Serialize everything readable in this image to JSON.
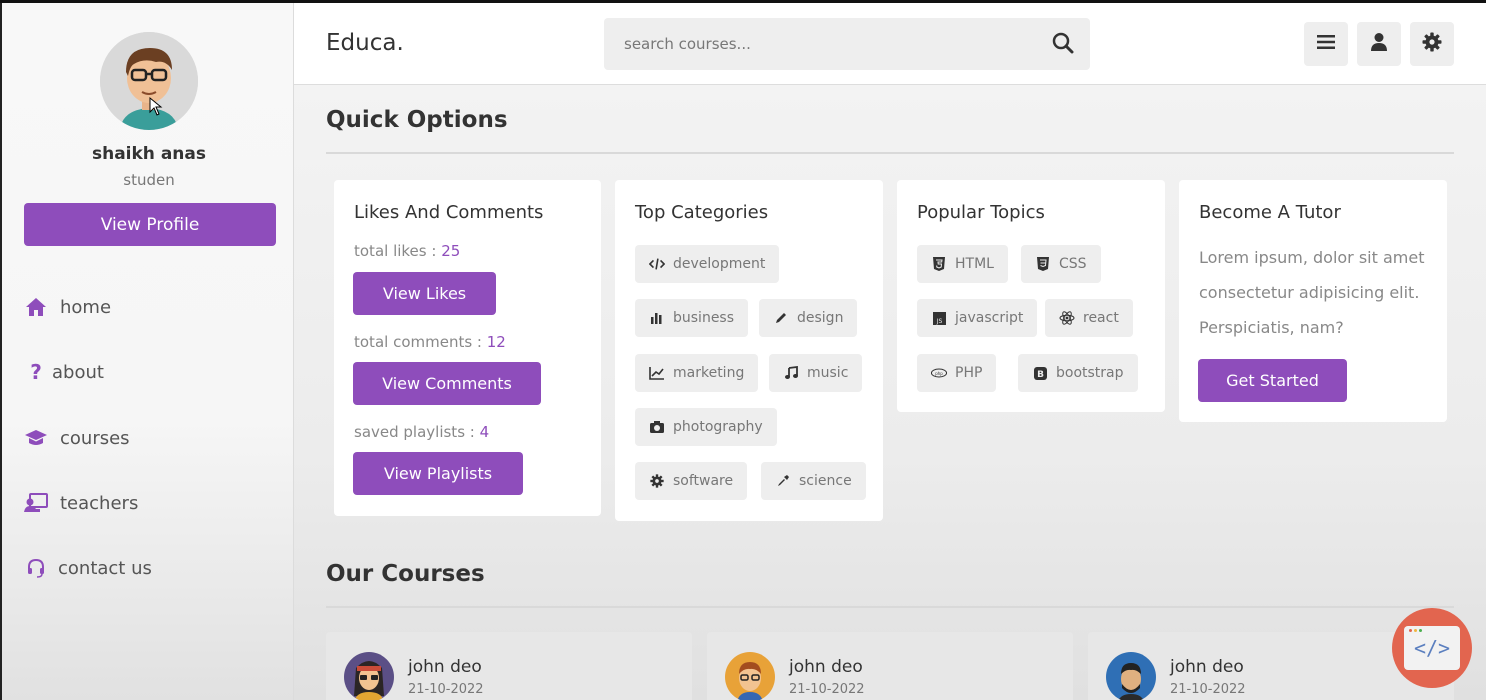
{
  "sidebar": {
    "profile": {
      "name": "shaikh anas",
      "role": "studen",
      "button": "View Profile"
    },
    "nav": [
      {
        "label": "home",
        "icon": "home-icon"
      },
      {
        "label": "about",
        "icon": "question-icon"
      },
      {
        "label": "courses",
        "icon": "graduation-cap-icon"
      },
      {
        "label": "teachers",
        "icon": "chalkboard-teacher-icon"
      },
      {
        "label": "contact us",
        "icon": "headset-icon"
      }
    ]
  },
  "header": {
    "logo": "Educa.",
    "search": {
      "placeholder": "search courses..."
    },
    "icons": [
      "menu-icon",
      "user-icon",
      "gear-icon"
    ]
  },
  "quick_options": {
    "title": "Quick Options",
    "likes_card": {
      "title": "Likes And Comments",
      "likes_label": "total likes : ",
      "likes_value": "25",
      "likes_button": "View Likes",
      "comments_label": "total comments : ",
      "comments_value": "12",
      "comments_button": "View Comments",
      "playlists_label": "saved playlists : ",
      "playlists_value": "4",
      "playlists_button": "View Playlists"
    },
    "categories_card": {
      "title": "Top Categories",
      "tags": [
        {
          "label": "development",
          "icon": "code-icon"
        },
        {
          "label": "business",
          "icon": "bar-chart-icon"
        },
        {
          "label": "design",
          "icon": "pen-icon"
        },
        {
          "label": "marketing",
          "icon": "line-chart-icon"
        },
        {
          "label": "music",
          "icon": "music-icon"
        },
        {
          "label": "photography",
          "icon": "camera-icon"
        },
        {
          "label": "software",
          "icon": "gear-icon"
        },
        {
          "label": "science",
          "icon": "eyedropper-icon"
        }
      ]
    },
    "topics_card": {
      "title": "Popular Topics",
      "tags": [
        {
          "label": "HTML",
          "icon": "html5-icon"
        },
        {
          "label": "CSS",
          "icon": "css3-icon"
        },
        {
          "label": "javascript",
          "icon": "js-icon"
        },
        {
          "label": "react",
          "icon": "react-icon"
        },
        {
          "label": "PHP",
          "icon": "php-icon"
        },
        {
          "label": "bootstrap",
          "icon": "bootstrap-icon"
        }
      ]
    },
    "tutor_card": {
      "title": "Become A Tutor",
      "description": "Lorem ipsum, dolor sit amet consectetur adipisicing elit. Perspiciatis, nam?",
      "button": "Get Started"
    }
  },
  "our_courses": {
    "title": "Our Courses",
    "items": [
      {
        "tutor": "john deo",
        "date": "21-10-2022"
      },
      {
        "tutor": "john deo",
        "date": "21-10-2022"
      },
      {
        "tutor": "john deo",
        "date": "21-10-2022"
      }
    ]
  },
  "colors": {
    "accent": "#8e4dbb",
    "badge": "#e2654f"
  }
}
